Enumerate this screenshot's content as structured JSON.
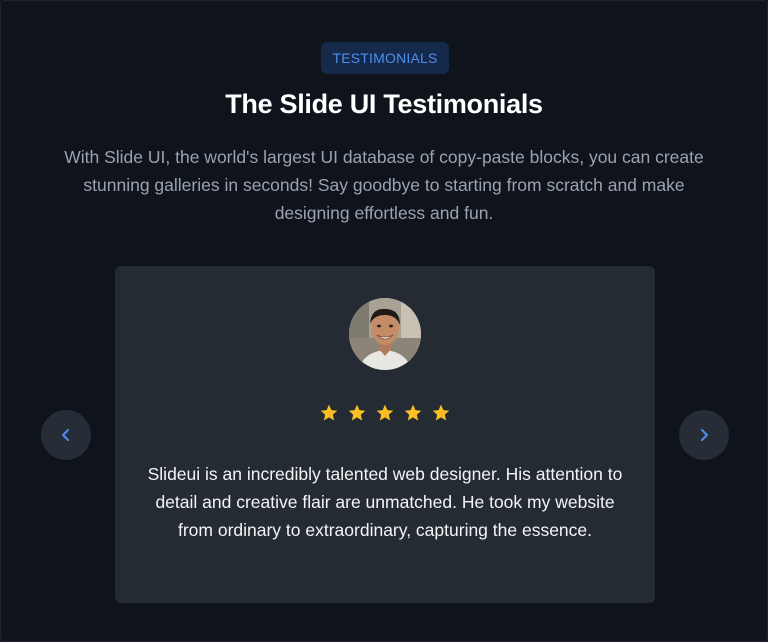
{
  "section": {
    "badge": "TESTIMONIALS",
    "title": "The Slide UI Testimonials",
    "subtitle": "With Slide UI, the world's largest UI database of copy-paste blocks, you can create stunning galleries in seconds! Say goodbye to starting from scratch and make designing effortless and fun."
  },
  "testimonial": {
    "rating": 5,
    "max_rating": 5,
    "quote": "Slideui is an incredibly talented web designer. His attention to detail and creative flair are unmatched. He took my website from ordinary to extraordinary, capturing the essence."
  },
  "navigation": {
    "prev_icon": "chevron-left-icon",
    "next_icon": "chevron-right-icon"
  },
  "colors": {
    "background": "#0e131c",
    "card": "#252b33",
    "accent": "#4f8ef0",
    "star": "#fbbf24",
    "badge_bg": "#15294a"
  }
}
